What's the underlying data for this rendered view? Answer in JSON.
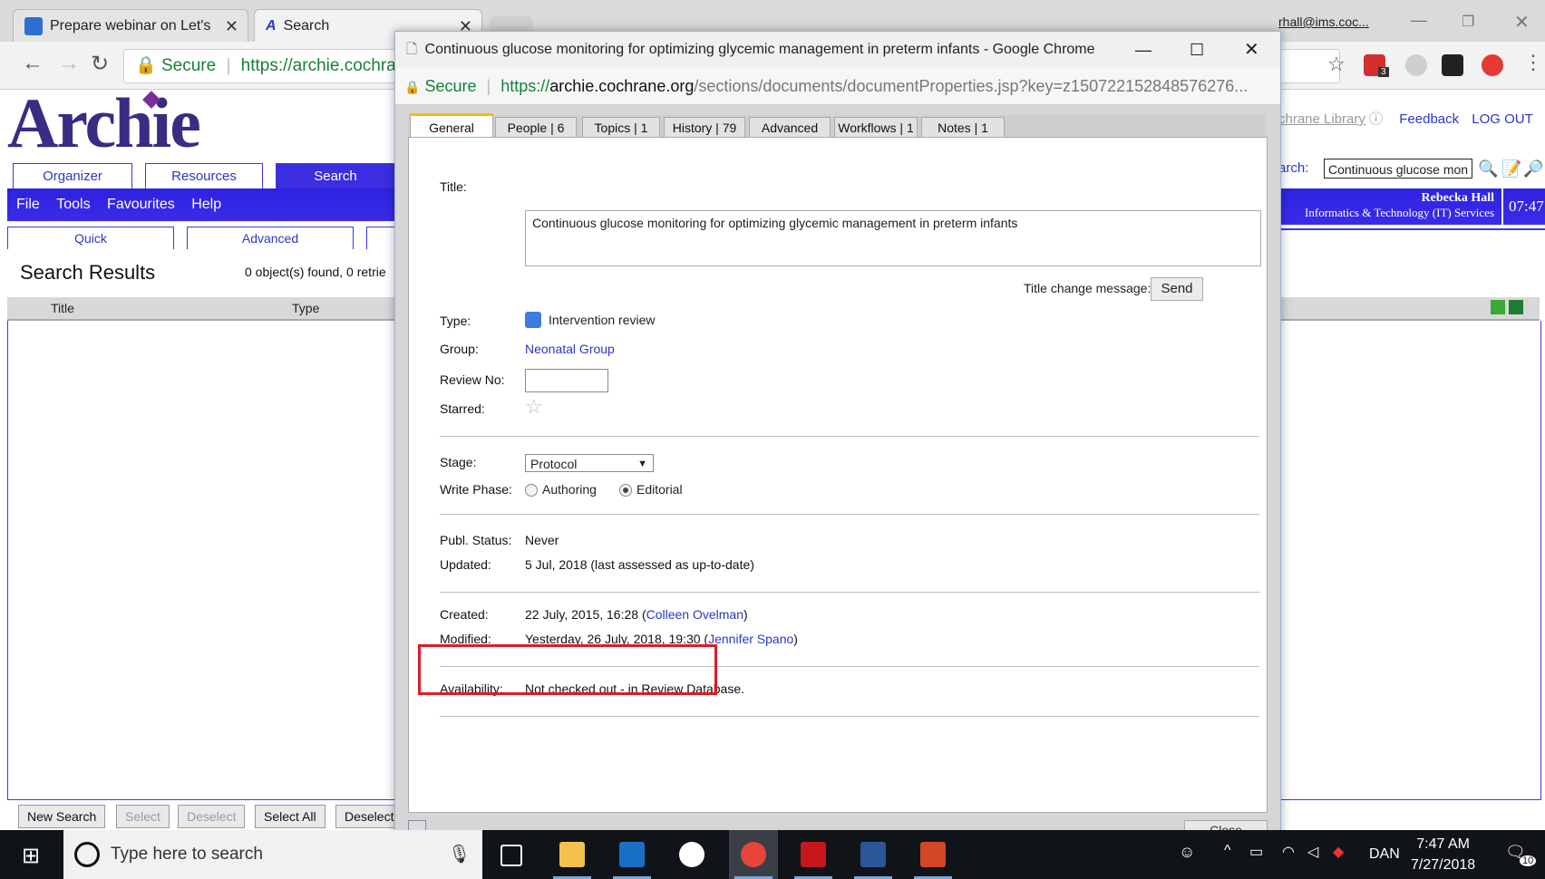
{
  "browser": {
    "tabs": [
      {
        "title": "Prepare webinar on Let's",
        "active": false
      },
      {
        "title": "Search",
        "active": true
      }
    ],
    "secure_label": "Secure",
    "address": "https://archie.cochrane",
    "profile_email": "rhall@ims.coc...",
    "ext_badge": "3"
  },
  "archie": {
    "logo": "Archie",
    "main_tabs": [
      "Organizer",
      "Resources",
      "Search"
    ],
    "menu": [
      "File",
      "Tools",
      "Favourites",
      "Help"
    ],
    "sub_tabs": [
      "Quick",
      "Advanced"
    ],
    "results_title": "Search Results",
    "objects_found": "0 object(s) found, 0 retrie",
    "columns": [
      "Title",
      "Type"
    ],
    "links": {
      "library": "chrane Library",
      "feedback": "Feedback",
      "logout": "LOG OUT"
    },
    "search_label": "arch:",
    "search_value": "Continuous glucose mon",
    "user_name": "Rebecka Hall",
    "user_dept": "Informatics & Technology (IT) Services",
    "clock": "07:47",
    "bottom_buttons": [
      {
        "label": "New Search",
        "enabled": true
      },
      {
        "label": "Select",
        "enabled": false
      },
      {
        "label": "Deselect",
        "enabled": false
      },
      {
        "label": "Select All",
        "enabled": true
      },
      {
        "label": "Deselect",
        "enabled": true
      }
    ]
  },
  "popup": {
    "window_title": "Continuous glucose monitoring for optimizing glycemic management in preterm infants - Google Chrome",
    "secure_label": "Secure",
    "url_scheme": "https://",
    "url_host": "archie.cochrane.org",
    "url_path": "/sections/documents/documentProperties.jsp?key=z150722152848576276...",
    "tabs": [
      {
        "label": "General",
        "active": true
      },
      {
        "label": "People | 6"
      },
      {
        "label": "Topics | 1"
      },
      {
        "label": "History | 79"
      },
      {
        "label": "Advanced"
      },
      {
        "label": "Workflows | 1"
      },
      {
        "label": "Notes | 1"
      }
    ],
    "fields": {
      "title_label": "Title:",
      "title_value": "Continuous glucose monitoring for optimizing glycemic management in preterm infants",
      "title_change_label": "Title change message:",
      "send_label": "Send",
      "type_label": "Type:",
      "type_value": "Intervention review",
      "group_label": "Group:",
      "group_value": "Neonatal Group",
      "review_no_label": "Review No:",
      "review_no_value": "",
      "starred_label": "Starred:",
      "stage_label": "Stage:",
      "stage_value": "Protocol",
      "write_phase_label": "Write Phase:",
      "write_phase_options": [
        "Authoring",
        "Editorial"
      ],
      "write_phase_selected": "Editorial",
      "publ_status_label": "Publ. Status:",
      "publ_status_value": "Never",
      "updated_label": "Updated:",
      "updated_value": "5 Jul, 2018 (last assessed as up-to-date)",
      "created_label": "Created:",
      "created_date": "22 July, 2015, 16:28 (",
      "created_by": "Colleen Ovelman",
      "modified_label": "Modified:",
      "modified_date": "Yesterday, 26 July, 2018, 19:30 (",
      "modified_by": "Jennifer Spano",
      "paren_close": ")",
      "availability_label": "Availability:",
      "availability_value": "Not checked out - in Review Database."
    },
    "close_label": "Close"
  },
  "taskbar": {
    "search_placeholder": "Type here to search",
    "tray_lang": "DAN",
    "time": "7:47 AM",
    "date": "7/27/2018",
    "notifications": "10"
  },
  "colors": {
    "archie_blue": "#3b2ee0",
    "link": "#2a37c8",
    "highlight": "#e01b24",
    "secure_green": "#188038"
  }
}
